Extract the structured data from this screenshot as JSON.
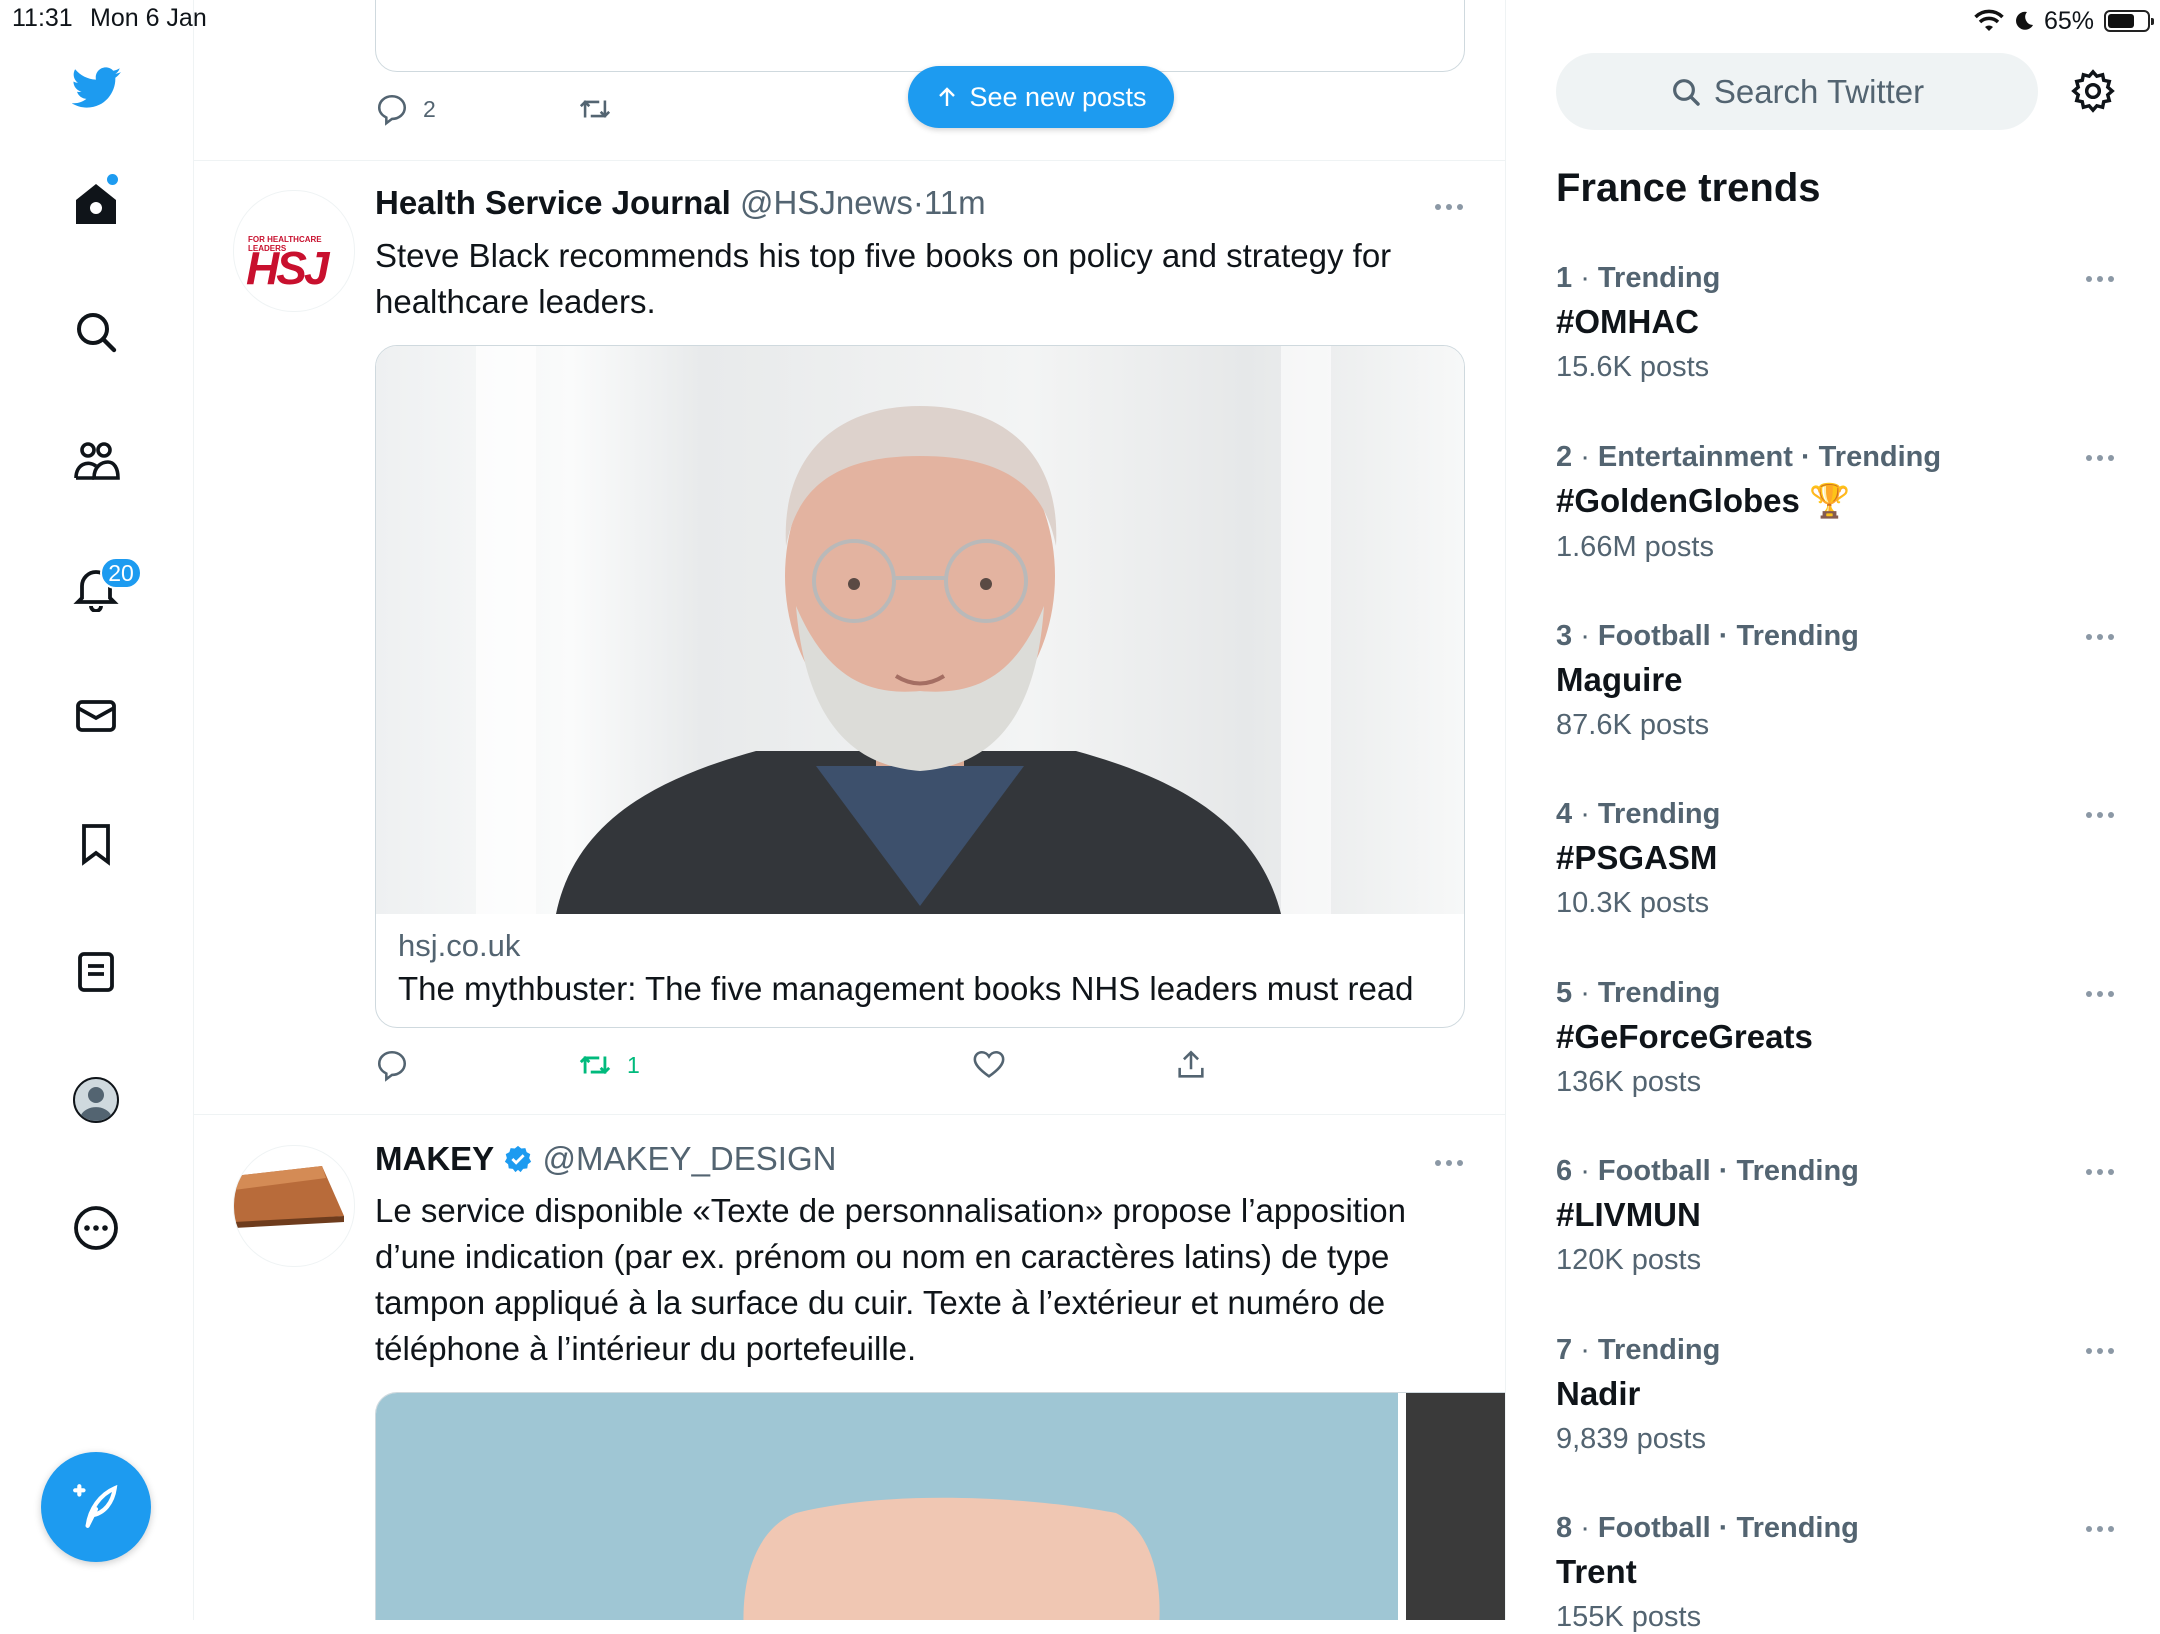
{
  "status_bar": {
    "time": "11:31",
    "date": "Mon 6 Jan",
    "battery": "65%"
  },
  "nav": {
    "notifications_badge": "20"
  },
  "feed": {
    "new_posts_label": "See new posts",
    "prev_tweet": {
      "reply_count": "2"
    },
    "tweet1": {
      "name": "Health Service Journal",
      "handle": "@HSJnews",
      "separator": "·",
      "time": "11m",
      "text": "Steve Black recommends his top five books on policy and strategy for healthcare leaders.",
      "avatar_text": "HSJ",
      "avatar_subtext": "FOR HEALTHCARE LEADERS",
      "card_domain": "hsj.co.uk",
      "card_title": "The mythbuster: The five management books NHS leaders must read",
      "retweet_count": "1"
    },
    "tweet2": {
      "name": "MAKEY",
      "handle": "@MAKEY_DESIGN",
      "text": "Le service disponible «Texte de personnalisation» propose l’apposition d’une indication (par ex. prénom ou nom en caractères latins) de type tampon appliqué à la surface du cuir. Texte à l’extérieur et numéro de téléphone à l’intérieur du portefeuille."
    }
  },
  "sidebar": {
    "search_placeholder": "Search Twitter",
    "trends_title": "France trends",
    "trends": [
      {
        "rank": "1",
        "category": "Trending",
        "name": "#OMHAC",
        "count": "15.6K posts"
      },
      {
        "rank": "2",
        "category": "Entertainment · Trending",
        "name": "#GoldenGlobes",
        "count": "1.66M posts",
        "emoji": "🏆"
      },
      {
        "rank": "3",
        "category": "Football · Trending",
        "name": "Maguire",
        "count": "87.6K posts"
      },
      {
        "rank": "4",
        "category": "Trending",
        "name": "#PSGASM",
        "count": "10.3K posts"
      },
      {
        "rank": "5",
        "category": "Trending",
        "name": "#GeForceGreats",
        "count": "136K posts"
      },
      {
        "rank": "6",
        "category": "Football · Trending",
        "name": "#LIVMUN",
        "count": "120K posts"
      },
      {
        "rank": "7",
        "category": "Trending",
        "name": "Nadir",
        "count": "9,839 posts"
      },
      {
        "rank": "8",
        "category": "Football · Trending",
        "name": "Trent",
        "count": "155K posts"
      }
    ]
  },
  "colors": {
    "accent": "#1d9bf0",
    "retweet_green": "#00ba7c",
    "secondary_text": "#536471"
  },
  "icons": [
    "twitter-logo-icon",
    "home-icon",
    "search-icon",
    "communities-icon",
    "bell-icon",
    "mail-icon",
    "bookmark-icon",
    "lists-icon",
    "profile-icon",
    "more-icon",
    "compose-icon",
    "reply-icon",
    "retweet-icon",
    "like-icon",
    "share-icon",
    "settings-icon",
    "verified-icon"
  ]
}
